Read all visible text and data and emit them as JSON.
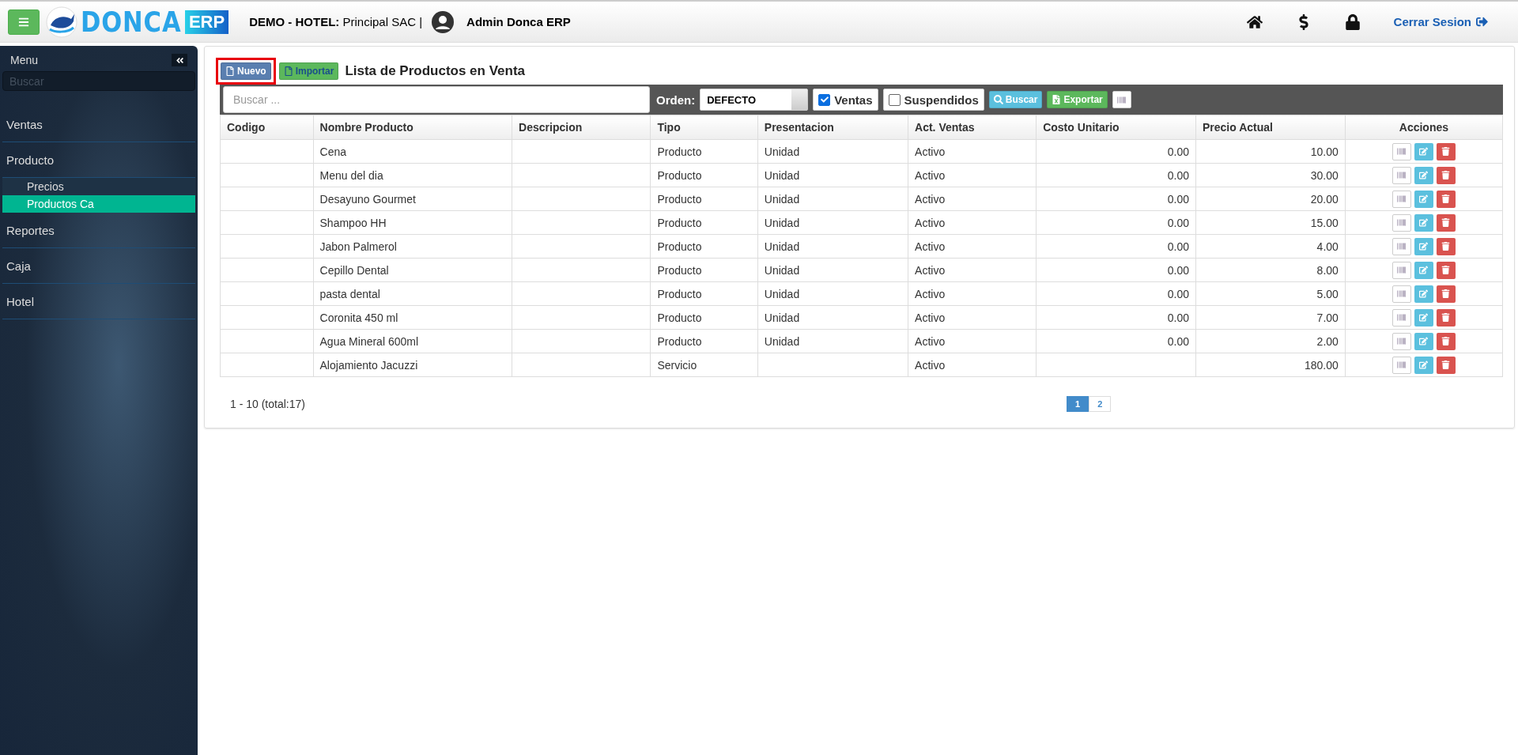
{
  "header": {
    "logo_text": "DONCA",
    "logo_badge": "ERP",
    "company_label": "DEMO - HOTEL:",
    "company": "Principal SAC |",
    "user": "Admin Donca ERP",
    "logout": "Cerrar Sesion"
  },
  "sidebar": {
    "title": "Menu",
    "search_placeholder": "Buscar",
    "items": [
      {
        "label": "Ventas"
      },
      {
        "label": "Producto",
        "children": [
          {
            "label": "Precios",
            "selected": false
          },
          {
            "label": "Productos Ca",
            "selected": true
          }
        ]
      },
      {
        "label": "Reportes"
      },
      {
        "label": "Caja"
      },
      {
        "label": "Hotel"
      }
    ]
  },
  "panel": {
    "new_button": {
      "label": "Nuevo",
      "highlighted": true
    },
    "import_button": "Importar",
    "title": "Lista de Productos en Venta"
  },
  "toolbar": {
    "search_placeholder": "Buscar ...",
    "order_label": "Orden:",
    "order_value": "DEFECTO",
    "filters": [
      {
        "label": "Ventas",
        "checked": true
      },
      {
        "label": "Suspendidos",
        "checked": false
      }
    ],
    "search_button": "Buscar",
    "export_button": "Exportar"
  },
  "table": {
    "columns": [
      "Codigo",
      "Nombre Producto",
      "Descripcion",
      "Tipo",
      "Presentacion",
      "Act. Ventas",
      "Costo Unitario",
      "Precio Actual",
      "Acciones"
    ],
    "rows": [
      [
        "",
        "Cena",
        "",
        "Producto",
        "Unidad",
        "Activo",
        "0.00",
        "10.00"
      ],
      [
        "",
        "Menu del dia",
        "",
        "Producto",
        "Unidad",
        "Activo",
        "0.00",
        "30.00"
      ],
      [
        "",
        "Desayuno Gourmet",
        "",
        "Producto",
        "Unidad",
        "Activo",
        "0.00",
        "20.00"
      ],
      [
        "",
        "Shampoo HH",
        "",
        "Producto",
        "Unidad",
        "Activo",
        "0.00",
        "15.00"
      ],
      [
        "",
        "Jabon Palmerol",
        "",
        "Producto",
        "Unidad",
        "Activo",
        "0.00",
        "4.00"
      ],
      [
        "",
        "Cepillo Dental",
        "",
        "Producto",
        "Unidad",
        "Activo",
        "0.00",
        "8.00"
      ],
      [
        "",
        "pasta dental",
        "",
        "Producto",
        "Unidad",
        "Activo",
        "0.00",
        "5.00"
      ],
      [
        "",
        "Coronita 450 ml",
        "",
        "Producto",
        "Unidad",
        "Activo",
        "0.00",
        "7.00"
      ],
      [
        "",
        "Agua Mineral 600ml",
        "",
        "Producto",
        "Unidad",
        "Activo",
        "0.00",
        "2.00"
      ],
      [
        "",
        "Alojamiento Jacuzzi",
        "",
        "Servicio",
        "",
        "Activo",
        "",
        "180.00"
      ]
    ]
  },
  "footer": {
    "range": "1 - 10 (total:17)",
    "pages": [
      {
        "label": "1",
        "selected": true
      },
      {
        "label": "2",
        "selected": false
      }
    ]
  }
}
